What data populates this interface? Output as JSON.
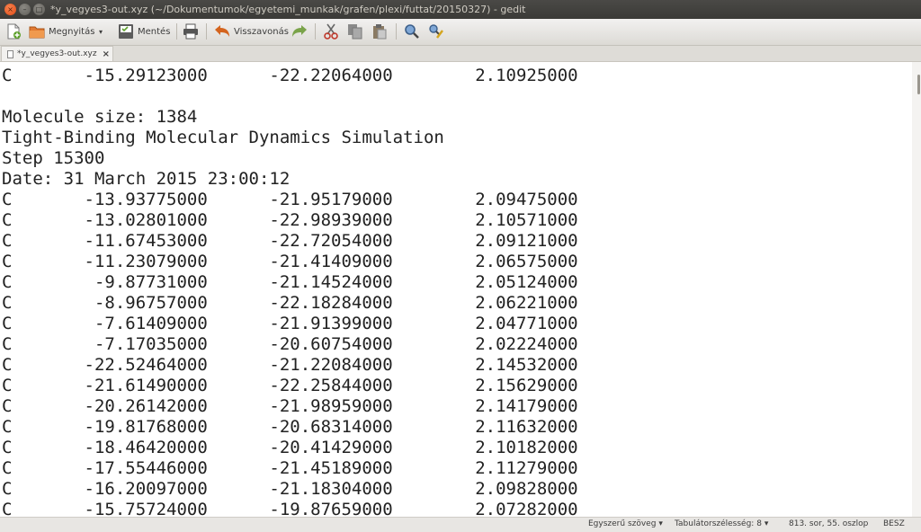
{
  "window": {
    "title": "*y_vegyes3-out.xyz (~/Dokumentumok/egyetemi_munkak/grafen/plexi/futtat/20150327) - gedit",
    "close_glyph": "×",
    "minimize_glyph": "–",
    "maximize_glyph": "□"
  },
  "toolbar": {
    "new_icon": "new-document-icon",
    "open_label": "Megnyitás",
    "open_dropdown_glyph": "▾",
    "save_label": "Mentés",
    "print_icon": "printer-icon",
    "undo_label": "Visszavonás",
    "redo_icon": "redo-icon",
    "cut_icon": "scissors-icon",
    "copy_icon": "copy-icon",
    "paste_icon": "paste-icon",
    "find_icon": "search-icon",
    "replace_icon": "replace-icon"
  },
  "tab": {
    "label": "*y_vegyes3-out.xyz",
    "close_glyph": "×"
  },
  "editor": {
    "lines": [
      "C       -15.29123000      -22.22064000        2.10925000",
      "",
      "Molecule size: 1384",
      "Tight-Binding Molecular Dynamics Simulation",
      "Step 15300",
      "Date: 31 March 2015 23:00:12",
      "C       -13.93775000      -21.95179000        2.09475000",
      "C       -13.02801000      -22.98939000        2.10571000",
      "C       -11.67453000      -22.72054000        2.09121000",
      "C       -11.23079000      -21.41409000        2.06575000",
      "C        -9.87731000      -21.14524000        2.05124000",
      "C        -8.96757000      -22.18284000        2.06221000",
      "C        -7.61409000      -21.91399000        2.04771000",
      "C        -7.17035000      -20.60754000        2.02224000",
      "C       -22.52464000      -21.22084000        2.14532000",
      "C       -21.61490000      -22.25844000        2.15629000",
      "C       -20.26142000      -21.98959000        2.14179000",
      "C       -19.81768000      -20.68314000        2.11632000",
      "C       -18.46420000      -20.41429000        2.10182000",
      "C       -17.55446000      -21.45189000        2.11279000",
      "C       -16.20097000      -21.18304000        2.09828000",
      "C       -15.75724000      -19.87659000        2.07282000"
    ]
  },
  "statusbar": {
    "syntax_label": "Egyszerű szöveg",
    "syntax_dropdown_glyph": "▾",
    "tab_width_label": "Tabulátorszélesség: 8",
    "tab_width_dropdown_glyph": "▾",
    "cursor_position": "813. sor, 55. oszlop",
    "insert_mode": "BESZ"
  },
  "colors": {
    "titlebar_bg": "#3c3b37",
    "close_button": "#e9541e",
    "editor_text": "#222222",
    "editor_bg": "#ffffff"
  }
}
